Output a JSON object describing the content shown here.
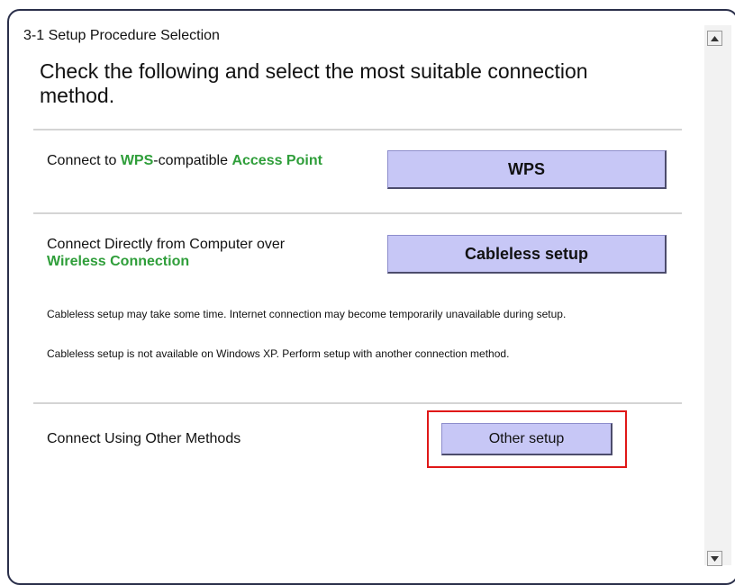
{
  "header": {
    "page_title": "3-1 Setup Procedure Selection",
    "headline": "Check the following and select the most suitable connection method."
  },
  "options": {
    "wps": {
      "label_prefix": "Connect to ",
      "label_wps": "WPS",
      "label_middle": "-compatible ",
      "label_access_point": "Access Point",
      "button_label": "WPS"
    },
    "cableless": {
      "label_line1": "Connect Directly from Computer over",
      "label_line2": "Wireless Connection",
      "button_label": "Cableless setup",
      "note1": "Cableless setup may take some time. Internet connection may become temporarily unavailable during setup.",
      "note2": "Cableless setup is not available on Windows XP. Perform setup with another connection method."
    },
    "other": {
      "label": "Connect Using Other Methods",
      "button_label": "Other setup"
    }
  },
  "colors": {
    "accent_green": "#2f9e3a",
    "button_fill": "#c7c7f6",
    "highlight_red": "#e01818"
  },
  "icons": {
    "scroll_up": "triangle-up",
    "scroll_down": "triangle-down"
  }
}
